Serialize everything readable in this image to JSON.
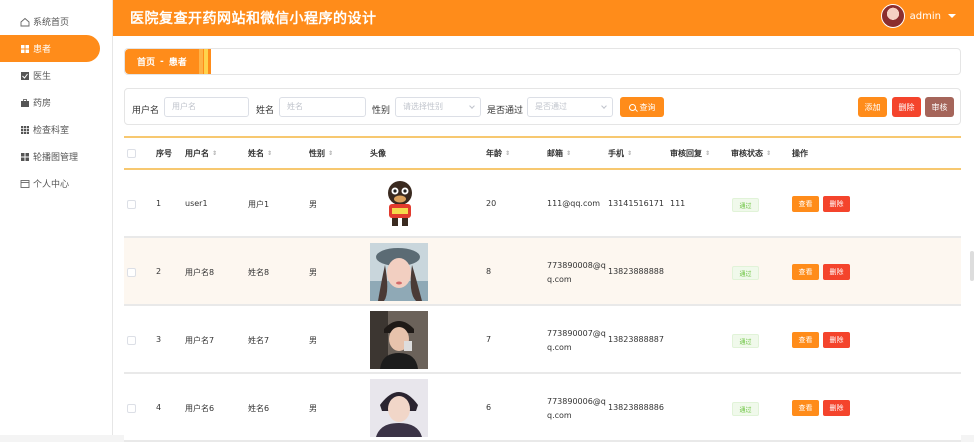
{
  "app": {
    "title": "医院复查开药网站和微信小程序的设计",
    "user": "admin"
  },
  "sidebar": {
    "items": [
      {
        "label": "系统首页",
        "icon": "home-icon"
      },
      {
        "label": "患者",
        "icon": "grid-icon"
      },
      {
        "label": "医生",
        "icon": "checkbox-icon"
      },
      {
        "label": "药房",
        "icon": "briefcase-icon"
      },
      {
        "label": "检查科室",
        "icon": "apps-icon"
      },
      {
        "label": "轮播图管理",
        "icon": "grid-icon"
      },
      {
        "label": "个人中心",
        "icon": "window-icon"
      }
    ]
  },
  "breadcrumb": {
    "home": "首页",
    "separator": "-",
    "current": "患者"
  },
  "filters": {
    "username_label": "用户名",
    "username_placeholder": "用户名",
    "name_label": "姓名",
    "name_placeholder": "姓名",
    "gender_label": "性别",
    "gender_placeholder": "请选择性别",
    "approved_label": "是否通过",
    "approved_placeholder": "是否通过",
    "search_label": "查询"
  },
  "toolbar": {
    "add": "添加",
    "delete": "删除",
    "review": "审核"
  },
  "table": {
    "columns": [
      "序号",
      "用户名",
      "姓名",
      "性别",
      "头像",
      "年龄",
      "邮箱",
      "手机",
      "审核回复",
      "审核状态",
      "操作"
    ],
    "rows": [
      {
        "index": "1",
        "username": "user1",
        "name": "用户1",
        "gender": "男",
        "age": "20",
        "email_line1": "111@qq.com",
        "email_line2": "",
        "phone": "13141516171",
        "reply": "111",
        "status": "通过"
      },
      {
        "index": "2",
        "username": "用户名8",
        "name": "姓名8",
        "gender": "男",
        "age": "8",
        "email_line1": "773890008@q",
        "email_line2": "q.com",
        "phone": "13823888888",
        "reply": "",
        "status": "通过"
      },
      {
        "index": "3",
        "username": "用户名7",
        "name": "姓名7",
        "gender": "男",
        "age": "7",
        "email_line1": "773890007@q",
        "email_line2": "q.com",
        "phone": "13823888887",
        "reply": "",
        "status": "通过"
      },
      {
        "index": "4",
        "username": "用户名6",
        "name": "姓名6",
        "gender": "男",
        "age": "6",
        "email_line1": "773890006@q",
        "email_line2": "q.com",
        "phone": "13823888886",
        "reply": "",
        "status": "通过"
      }
    ],
    "view_label": "查看",
    "delete_label": "删除"
  },
  "colors": {
    "accent": "#ff8c1a",
    "danger": "#f4442c",
    "review": "#a5655a",
    "success": "#67c23a"
  }
}
